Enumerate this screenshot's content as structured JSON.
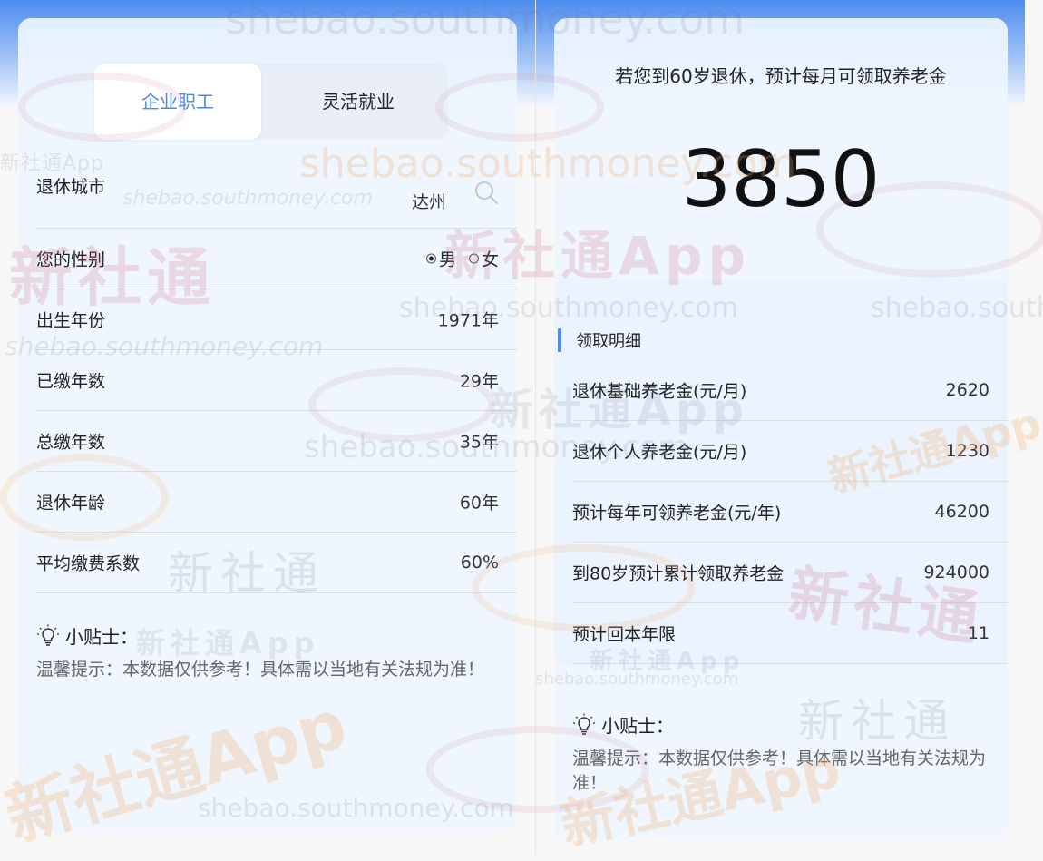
{
  "watermark": {
    "url": "shebao.southmoney.com",
    "brand": "新社通",
    "brand_app": "新社通App"
  },
  "calculator": {
    "tabs": [
      {
        "label": "企业职工",
        "active": true
      },
      {
        "label": "灵活就业",
        "active": false
      }
    ],
    "fields": {
      "city": {
        "label": "退休城市",
        "value": "达州"
      },
      "gender": {
        "label": "您的性别",
        "options": [
          {
            "label": "男",
            "selected": true
          },
          {
            "label": "女",
            "selected": false
          }
        ]
      },
      "birth_year": {
        "label": "出生年份",
        "value": "1971年"
      },
      "paid_years": {
        "label": "已缴年数",
        "value": "29年"
      },
      "total_years": {
        "label": "总缴年数",
        "value": "35年"
      },
      "retire_age": {
        "label": "退休年龄",
        "value": "60年"
      },
      "avg_ratio": {
        "label": "平均缴费系数",
        "value": "60%"
      }
    },
    "tip": {
      "title": "小贴士：",
      "text": "温馨提示：本数据仅供参考！具体需以当地有关法规为准！"
    }
  },
  "result": {
    "title": "若您到60岁退休，预计每月可领取养老金",
    "amount": "3850",
    "section_title": "领取明细",
    "details": [
      {
        "label": "退休基础养老金(元/月)",
        "value": "2620"
      },
      {
        "label": "退休个人养老金(元/月)",
        "value": "1230"
      },
      {
        "label": "预计每年可领养老金(元/年)",
        "value": "46200"
      },
      {
        "label": "到80岁预计累计领取养老金",
        "value": "924000"
      },
      {
        "label": "预计回本年限",
        "value": "11"
      }
    ],
    "tip": {
      "title": "小贴士：",
      "text": "温馨提示：本数据仅供参考！具体需以当地有关法规为准！"
    }
  },
  "colors": {
    "accent": "#4a8be8",
    "header_gradient_top": "#4b8cf0",
    "panel_bg": "#eef5fe",
    "divider": "#d9dde4"
  }
}
